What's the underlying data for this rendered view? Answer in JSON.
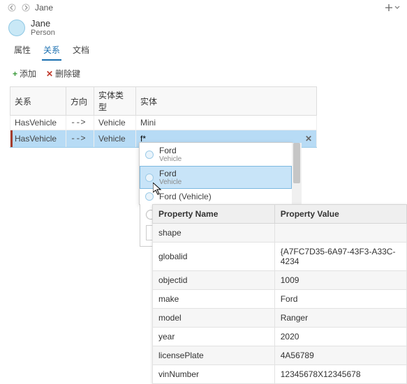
{
  "breadcrumb": {
    "name": "Jane"
  },
  "entity": {
    "name": "Jane",
    "type": "Person"
  },
  "tabs": {
    "t0": "属性",
    "t1": "关系",
    "t2": "文档"
  },
  "actions": {
    "add": "添加",
    "deleteKey": "删除键"
  },
  "table": {
    "headers": {
      "relation": "关系",
      "direction": "方向",
      "entityType": "实体类型",
      "entity": "实体"
    },
    "rows": [
      {
        "relation": "HasVehicle",
        "direction": "-->",
        "entityType": "Vehicle",
        "entity": "Mini"
      },
      {
        "relation": "HasVehicle",
        "direction": "-->",
        "entityType": "Vehicle",
        "entityInput": "f*"
      }
    ]
  },
  "suggestions": {
    "items": [
      {
        "label": "Ford",
        "sub": "Vehicle"
      },
      {
        "label": "Ford",
        "sub": "Vehicle"
      },
      {
        "label": "Ford (Vehicle)",
        "sub": ""
      }
    ]
  },
  "properties": {
    "headers": {
      "name": "Property Name",
      "value": "Property Value"
    },
    "rows": [
      {
        "name": "shape",
        "value": ""
      },
      {
        "name": "globalid",
        "value": "{A7FC7D35-6A97-43F3-A33C-4234"
      },
      {
        "name": "objectid",
        "value": "1009"
      },
      {
        "name": "make",
        "value": "Ford"
      },
      {
        "name": "model",
        "value": "Ranger"
      },
      {
        "name": "year",
        "value": "2020"
      },
      {
        "name": "licensePlate",
        "value": "4A56789"
      },
      {
        "name": "vinNumber",
        "value": "12345678X12345678"
      }
    ]
  }
}
